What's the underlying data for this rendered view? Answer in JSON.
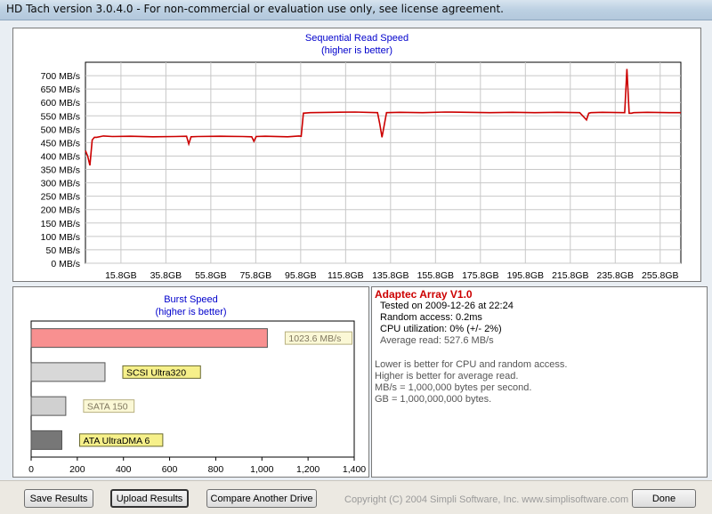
{
  "window": {
    "title": "HD Tach version 3.0.4.0  - For non-commercial or evaluation use only, see license agreement."
  },
  "seq_chart": {
    "title": "Sequential Read Speed",
    "subtitle": "(higher is better)",
    "series_color": "#cc0000"
  },
  "burst_chart": {
    "title": "Burst Speed",
    "subtitle": "(higher is better)"
  },
  "chart_data": [
    {
      "type": "line",
      "title": "Sequential Read Speed",
      "subtitle": "(higher is better)",
      "xlabel": "",
      "ylabel": "",
      "x_unit": "GB",
      "xlim": [
        0,
        265
      ],
      "ylim": [
        0,
        750
      ],
      "grid": true,
      "x_ticks": [
        "15.8GB",
        "35.8GB",
        "55.8GB",
        "75.8GB",
        "95.8GB",
        "115.8GB",
        "135.8GB",
        "155.8GB",
        "175.8GB",
        "195.8GB",
        "215.8GB",
        "235.8GB",
        "255.8GB"
      ],
      "y_ticks": [
        "0 MB/s",
        "50 MB/s",
        "100 MB/s",
        "150 MB/s",
        "200 MB/s",
        "250 MB/s",
        "300 MB/s",
        "350 MB/s",
        "400 MB/s",
        "450 MB/s",
        "500 MB/s",
        "550 MB/s",
        "600 MB/s",
        "650 MB/s",
        "700 MB/s"
      ],
      "series": [
        {
          "name": "",
          "color": "#cc0000",
          "x": [
            0,
            1,
            2,
            3,
            4,
            5,
            8,
            12,
            20,
            30,
            40,
            45,
            46,
            47,
            50,
            60,
            70,
            74,
            75,
            76,
            80,
            90,
            95,
            96,
            97,
            100,
            110,
            120,
            130,
            131,
            132,
            134,
            140,
            150,
            160,
            170,
            180,
            190,
            200,
            210,
            220,
            223,
            224,
            225,
            230,
            240,
            241,
            242,
            243,
            244,
            250,
            260,
            265
          ],
          "y": [
            420,
            400,
            365,
            460,
            470,
            470,
            475,
            473,
            474,
            472,
            473,
            474,
            445,
            472,
            473,
            474,
            473,
            472,
            455,
            473,
            474,
            472,
            475,
            474,
            560,
            562,
            563,
            564,
            562,
            520,
            470,
            562,
            563,
            562,
            564,
            563,
            562,
            563,
            562,
            563,
            562,
            535,
            560,
            562,
            563,
            562,
            725,
            560,
            560,
            562,
            563,
            562,
            562
          ]
        }
      ]
    },
    {
      "type": "bar",
      "orientation": "horizontal",
      "title": "Burst Speed",
      "subtitle": "(higher is better)",
      "xlim": [
        0,
        1400
      ],
      "x_ticks": [
        "0",
        "200",
        "400",
        "600",
        "800",
        "1,000",
        "1,200",
        "1,400"
      ],
      "bars": [
        {
          "label": "1023.6 MB/s",
          "value": 1023.6,
          "color": "#f89090"
        },
        {
          "label": "SCSI Ultra320",
          "value": 320,
          "color": "#d8d8d8"
        },
        {
          "label": "SATA 150",
          "value": 150,
          "color": "#d0d0d0"
        },
        {
          "label": "ATA UltraDMA 6",
          "value": 133,
          "color": "#777777"
        }
      ]
    }
  ],
  "info": {
    "title": "Adaptec Array V1.0",
    "tested": "Tested on 2009-12-26 at 22:24",
    "random_access": "Random access: 0.2ms",
    "cpu": "CPU utilization: 0% (+/- 2%)",
    "avg_read": "Average read: 527.6 MB/s",
    "note1": "Lower is better for CPU and random access.",
    "note2": "Higher is better for average read.",
    "note3": "MB/s = 1,000,000 bytes per second.",
    "note4": "GB = 1,000,000,000 bytes."
  },
  "footer": {
    "save": "Save Results",
    "upload": "Upload Results",
    "compare": "Compare Another Drive",
    "copyright": "Copyright (C) 2004 Simpli Software, Inc. www.simplisoftware.com",
    "done": "Done"
  }
}
